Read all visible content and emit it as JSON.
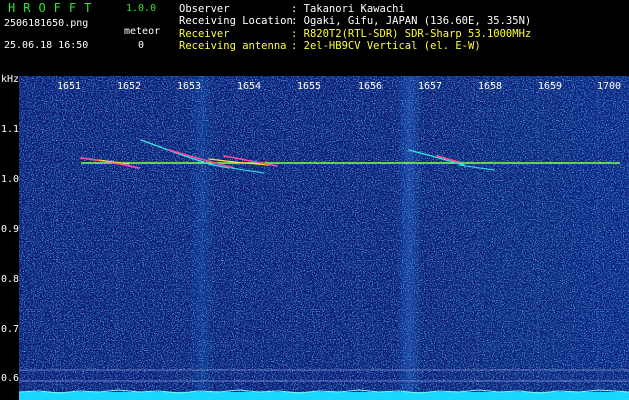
{
  "header": {
    "app_title": "HROFFT",
    "version": "1.0.0",
    "filename": "2506181650.png",
    "datetime": "25.06.18 16:50",
    "meteor_label": "meteor",
    "meteor_count": "0"
  },
  "info": [
    {
      "label": "Observer",
      "value": ": Takanori Kawachi"
    },
    {
      "label": "Receiving Location",
      "value": ": Ogaki, Gifu, JAPAN (136.60E, 35.35N)"
    },
    {
      "label": "Receiver",
      "value": ": R820T2(RTL-SDR) SDR-Sharp 53.1000MHz"
    },
    {
      "label": "Receiving antenna",
      "value": ": 2el-HB9CV Vertical (el. E-W)"
    }
  ],
  "axes": {
    "y_unit": "kHz",
    "y_ticks": [
      "1.1",
      "1.0",
      "0.9",
      "0.8",
      "0.7",
      "0.6"
    ],
    "x_ticks": [
      "1651",
      "1652",
      "1653",
      "1654",
      "1655",
      "1656",
      "1657",
      "1658",
      "1659",
      "1700"
    ]
  },
  "colors": {
    "background": "#000000",
    "noise_base": "#0a1f7a",
    "carrier": "#7fff5a",
    "echo": "#ff4a9a",
    "text_green": "#2ee62e",
    "text_yellow": "#ffff3a"
  }
}
